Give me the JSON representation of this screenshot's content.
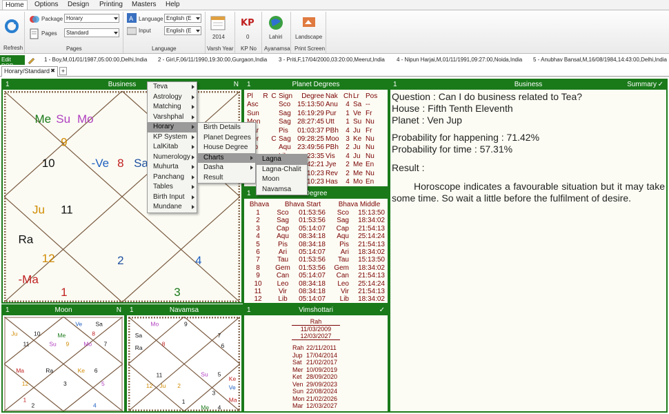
{
  "menubar": {
    "items": [
      "Home",
      "Options",
      "Design",
      "Printing",
      "Masters",
      "Help"
    ]
  },
  "ribbon": {
    "refresh": "Refresh",
    "package_label": "Package",
    "package_value": "Horary",
    "pages_label": "Pages",
    "pages_value": "Standard",
    "group_pages": "Pages",
    "language_label": "Language",
    "language_value": "English (E",
    "input_label": "Input",
    "input_value": "English (E",
    "group_language": "Language",
    "varsh_year": "2014",
    "group_varsh": "Varsh Year",
    "kp_value": "0",
    "group_kp": "KP No",
    "lahiri": "Lahiri",
    "group_ayanamsa": "Ayanamsa",
    "landscape": "Landscape",
    "group_print": "Print Screen",
    "colors": {
      "green": "#1a7a1a",
      "accent": "#1e6fbf"
    }
  },
  "profiles": {
    "edit_dob": "Edit DOB",
    "items": [
      "1 - Boy,M,01/01/1987,05:00:00,Delhi,India",
      "2 - Girl,F,06/11/1990,19:30:00,Gurgaon,India",
      "3 - Priti,F,17/04/2000,03:20:00,Meerut,India",
      "4 - Nipun Harjai,M,01/11/1991,09:27:00,Noida,India",
      "5 - Anubhav Bansal,M,16/08/1984,14:43:00,Delhi,India"
    ]
  },
  "tab": {
    "label": "Horary/Standard",
    "close": "✖",
    "add": "+"
  },
  "business_panel": {
    "num": "1",
    "title": "Business",
    "flag": "N"
  },
  "moon_panel": {
    "num": "1",
    "title": "Moon",
    "flag": "N"
  },
  "navamsa_panel": {
    "num": "1",
    "title": "Navamsa"
  },
  "planet_degrees_panel": {
    "num": "1",
    "title": "Planet Degrees",
    "headers": [
      "Pl",
      "R",
      "C",
      "Sign",
      "Degree",
      "Nak",
      "Ch",
      "Lr",
      "Pos"
    ],
    "rows": [
      [
        "Asc",
        "",
        "",
        "Sco",
        "15:13:50",
        "Anu",
        "4",
        "Sa",
        "--"
      ],
      [
        "Sun",
        "",
        "",
        "Sag",
        "16:19:29",
        "Pur",
        "1",
        "Ve",
        "Fr"
      ],
      [
        "Mon",
        "",
        "",
        "Sag",
        "28:27:45",
        "Utt",
        "1",
        "Su",
        "Nu"
      ],
      [
        "Mar",
        "",
        "",
        "Pis",
        "01:03:37",
        "PBh",
        "4",
        "Ju",
        "Fr"
      ],
      [
        "Mer",
        "",
        "C",
        "Sag",
        "09:28:25",
        "Moo",
        "3",
        "Ke",
        "Nu"
      ],
      [
        "Jup",
        "",
        "",
        "Aqu",
        "23:49:56",
        "PBh",
        "2",
        "Ju",
        "Nu"
      ],
      [
        "Ven",
        "",
        "",
        "Lib",
        "23:35",
        "Vis",
        "4",
        "Ju",
        "Nu"
      ],
      [
        "Sat",
        "",
        "",
        "Sco",
        "42:21",
        "Jye",
        "2",
        "Me",
        "En"
      ],
      [
        "Rah",
        "",
        "",
        "Lib",
        "10:23",
        "Rev",
        "2",
        "Me",
        "Nu"
      ],
      [
        "Ket",
        "",
        "",
        "Ari",
        "10:23",
        "Has",
        "4",
        "Mo",
        "En"
      ]
    ]
  },
  "bhava_panel": {
    "num": "1",
    "title": "Degree",
    "headers": [
      "Bhava",
      "Bhava Start",
      "Bhava Middle"
    ],
    "rows": [
      [
        "1",
        "Sco",
        "01:53:56",
        "Sco",
        "15:13:50"
      ],
      [
        "2",
        "Sag",
        "01:53:56",
        "Sag",
        "18:34:02"
      ],
      [
        "3",
        "Cap",
        "05:14:07",
        "Cap",
        "21:54:13"
      ],
      [
        "4",
        "Aqu",
        "08:34:18",
        "Aqu",
        "25:14:24"
      ],
      [
        "5",
        "Pis",
        "08:34:18",
        "Pis",
        "21:54:13"
      ],
      [
        "6",
        "Ari",
        "05:14:07",
        "Ari",
        "18:34:02"
      ],
      [
        "7",
        "Tau",
        "01:53:56",
        "Tau",
        "15:13:50"
      ],
      [
        "8",
        "Gem",
        "01:53:56",
        "Gem",
        "18:34:02"
      ],
      [
        "9",
        "Can",
        "05:14:07",
        "Can",
        "21:54:13"
      ],
      [
        "10",
        "Leo",
        "08:34:18",
        "Leo",
        "25:14:24"
      ],
      [
        "11",
        "Vir",
        "08:34:18",
        "Vir",
        "21:54:13"
      ],
      [
        "12",
        "Lib",
        "05:14:07",
        "Lib",
        "18:34:02"
      ]
    ]
  },
  "vimshottari_panel": {
    "num": "1",
    "title": "Vimshottari",
    "check": "✓",
    "current": "Rah",
    "from": "11/03/2009",
    "to": "12/03/2027",
    "rows": [
      [
        "Rah",
        "22/11/2011"
      ],
      [
        "Jup",
        "17/04/2014"
      ],
      [
        "Sat",
        "21/02/2017"
      ],
      [
        "Mer",
        "10/09/2019"
      ],
      [
        "Ket",
        "28/09/2020"
      ],
      [
        "Ven",
        "29/09/2023"
      ],
      [
        "Sun",
        "22/08/2024"
      ],
      [
        "Mon",
        "21/02/2026"
      ],
      [
        "Mar",
        "12/03/2027"
      ]
    ]
  },
  "summary_panel": {
    "num": "1",
    "title": "Business",
    "tab": "Summary",
    "check": "✓",
    "question": "Question : Can I do business related to Tea?",
    "house": "House : Fifth Tenth Eleventh",
    "planet": "Planet : Ven Jup",
    "prob_happening": "Probability for happening : 71.42%",
    "prob_time": "Probability for time : 57.31%",
    "result_label": "Result :",
    "result_text": "Horoscope indicates a favourable situation but it may take some time. So wait a little before the fulfilment of desire."
  },
  "context_menu": {
    "items": [
      "Teva",
      "Astrology",
      "Matching",
      "Varshphal",
      "Horary",
      "KP System",
      "LalKitab",
      "Numerology",
      "Muhurta",
      "Panchang",
      "Tables",
      "Birth Input",
      "Mundane"
    ]
  },
  "horary_submenu": {
    "items": [
      "Birth Details",
      "Planet Degrees",
      "House Degree",
      "Charts",
      "Dasha",
      "Result"
    ]
  },
  "charts_submenu": {
    "items": [
      "Lagna",
      "Lagna-Chalit",
      "Moon",
      "Navamsa"
    ]
  },
  "main_chart": [
    {
      "t": "Me",
      "c": "#1a7a1a"
    },
    {
      "t": "Su",
      "c": "#b040c0"
    },
    {
      "t": "Mo",
      "c": "#b040c0"
    },
    {
      "t": "9",
      "c": "#d08a00"
    },
    {
      "t": "10",
      "c": "#111"
    },
    {
      "t": "-Ve",
      "c": "#2060c0"
    },
    {
      "t": "8",
      "c": "#c02020"
    },
    {
      "t": "Sa",
      "c": "#1e50a0"
    },
    {
      "t": "Ju",
      "c": "#d08a00"
    },
    {
      "t": "11",
      "c": "#111"
    },
    {
      "t": "Ra",
      "c": "#111"
    },
    {
      "t": "12",
      "c": "#d08a00"
    },
    {
      "t": "-Ma",
      "c": "#c02020"
    },
    {
      "t": "1",
      "c": "#c02020"
    },
    {
      "t": "2",
      "c": "#2050a0"
    },
    {
      "t": "3",
      "c": "#1a7a1a"
    },
    {
      "t": "4",
      "c": "#2060c0"
    }
  ],
  "moon_chart": [
    {
      "t": "Ve",
      "c": "#2060c0"
    },
    {
      "t": "Sa",
      "c": "#111"
    },
    {
      "t": "Ju",
      "c": "#d08a00"
    },
    {
      "t": "10",
      "c": "#111"
    },
    {
      "t": "Me",
      "c": "#1a7a1a"
    },
    {
      "t": "8",
      "c": "#c02020"
    },
    {
      "t": "11",
      "c": "#111"
    },
    {
      "t": "Su",
      "c": "#b040c0"
    },
    {
      "t": "9",
      "c": "#d08a00"
    },
    {
      "t": "Mo",
      "c": "#b040c0"
    },
    {
      "t": "7",
      "c": "#111"
    },
    {
      "t": "Ma",
      "c": "#c02020"
    },
    {
      "t": "12",
      "c": "#d08a00"
    },
    {
      "t": "Ra",
      "c": "#111"
    },
    {
      "t": "Ke",
      "c": "#d08a00"
    },
    {
      "t": "6",
      "c": "#111"
    },
    {
      "t": "1",
      "c": "#c02020"
    },
    {
      "t": "3",
      "c": "#111"
    },
    {
      "t": "5",
      "c": "#b040c0"
    },
    {
      "t": "2",
      "c": "#111"
    },
    {
      "t": "4",
      "c": "#2060c0"
    }
  ],
  "navamsa_chart": [
    {
      "t": "Mo",
      "c": "#b040c0"
    },
    {
      "t": "Sa",
      "c": "#111"
    },
    {
      "t": "9",
      "c": "#111"
    },
    {
      "t": "Ra",
      "c": "#111"
    },
    {
      "t": "8",
      "c": "#c02020"
    },
    {
      "t": "6",
      "c": "#111"
    },
    {
      "t": "7",
      "c": "#111"
    },
    {
      "t": "11",
      "c": "#111"
    },
    {
      "t": "Su",
      "c": "#b040c0"
    },
    {
      "t": "5",
      "c": "#111"
    },
    {
      "t": "12",
      "c": "#d08a00"
    },
    {
      "t": "Ju",
      "c": "#d08a00"
    },
    {
      "t": "2",
      "c": "#d08a00"
    },
    {
      "t": "Ke",
      "c": "#c02020"
    },
    {
      "t": "Ve",
      "c": "#2060c0"
    },
    {
      "t": "Ma",
      "c": "#c02020"
    },
    {
      "t": "1",
      "c": "#111"
    },
    {
      "t": "3",
      "c": "#111"
    },
    {
      "t": "Me",
      "c": "#1a7a1a"
    },
    {
      "t": "4",
      "c": "#111"
    }
  ]
}
